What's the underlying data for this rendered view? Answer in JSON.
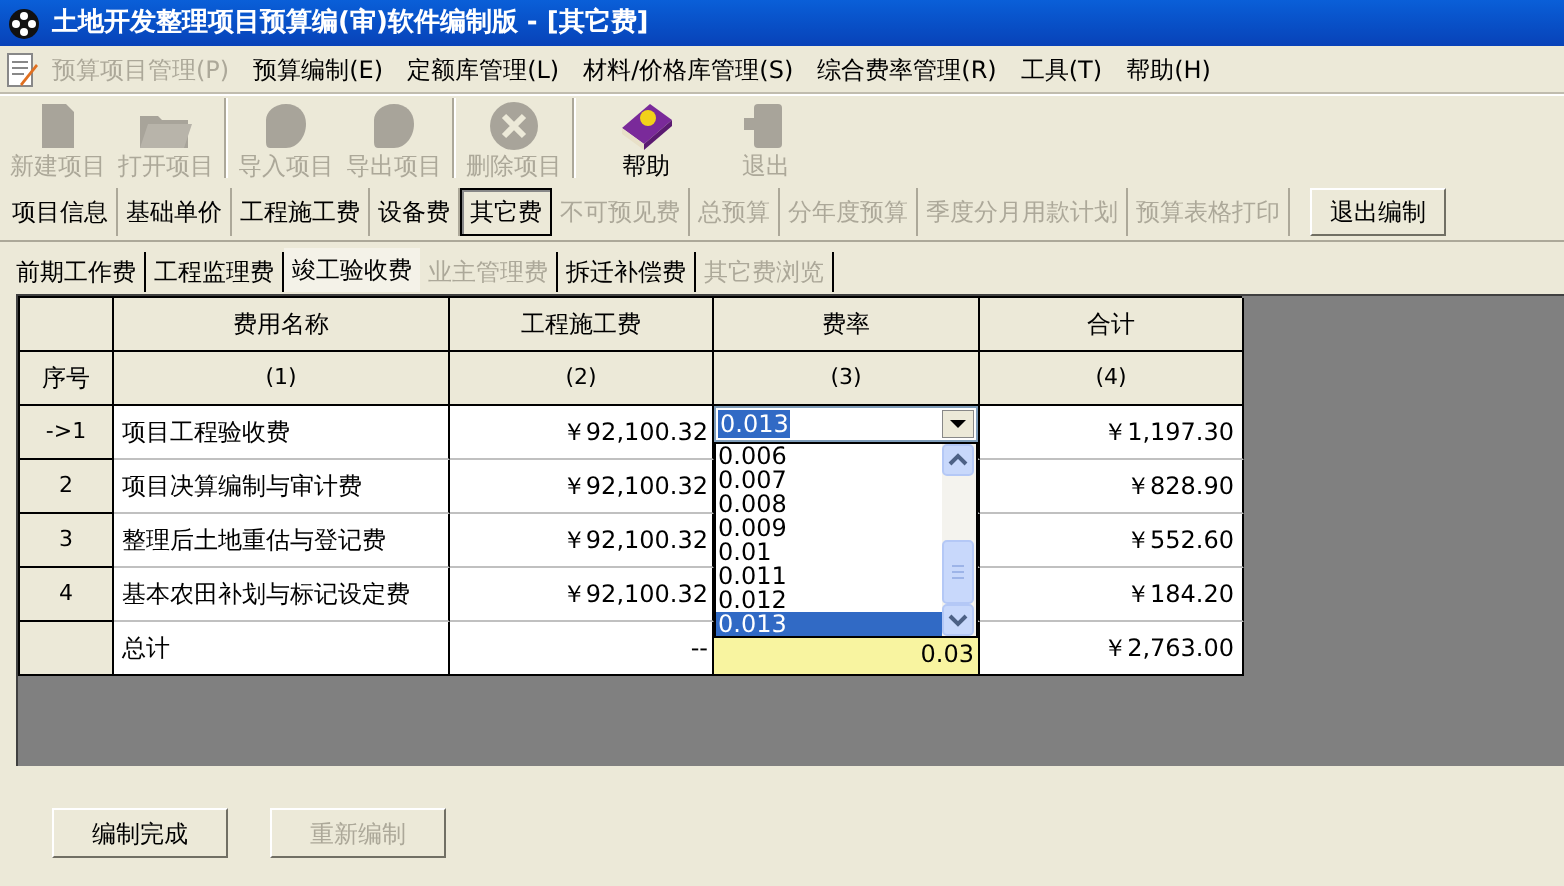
{
  "window": {
    "title": "土地开发整理项目预算编(审)软件编制版 - [其它费]"
  },
  "menu": [
    {
      "label": "预算项目管理(P)",
      "disabled": true
    },
    {
      "label": "预算编制(E)",
      "disabled": false
    },
    {
      "label": "定额库管理(L)",
      "disabled": false
    },
    {
      "label": "材料/价格库管理(S)",
      "disabled": false
    },
    {
      "label": "综合费率管理(R)",
      "disabled": false
    },
    {
      "label": "工具(T)",
      "disabled": false
    },
    {
      "label": "帮助(H)",
      "disabled": false
    }
  ],
  "toolbar": [
    {
      "label": "新建项目",
      "kind": "new",
      "disabled": true
    },
    {
      "label": "打开项目",
      "kind": "open",
      "disabled": true
    },
    {
      "label": "导入项目",
      "kind": "import",
      "disabled": true
    },
    {
      "label": "导出项目",
      "kind": "export",
      "disabled": true
    },
    {
      "label": "删除项目",
      "kind": "delete",
      "disabled": true
    },
    {
      "label": "帮助",
      "kind": "help",
      "disabled": false
    },
    {
      "label": "退出",
      "kind": "exit",
      "disabled": true
    }
  ],
  "nav_tabs": [
    {
      "label": "项目信息",
      "selected": false,
      "disabled": false
    },
    {
      "label": "基础单价",
      "selected": false,
      "disabled": false
    },
    {
      "label": "工程施工费",
      "selected": false,
      "disabled": false
    },
    {
      "label": "设备费",
      "selected": false,
      "disabled": false
    },
    {
      "label": "其它费",
      "selected": true,
      "disabled": false
    },
    {
      "label": "不可预见费",
      "selected": false,
      "disabled": true
    },
    {
      "label": "总预算",
      "selected": false,
      "disabled": true
    },
    {
      "label": "分年度预算",
      "selected": false,
      "disabled": true
    },
    {
      "label": "季度分月用款计划",
      "selected": false,
      "disabled": true
    },
    {
      "label": "预算表格打印",
      "selected": false,
      "disabled": true
    }
  ],
  "exit_edit_button": "退出编制",
  "sub_tabs": [
    {
      "label": "前期工作费",
      "selected": false,
      "disabled": false
    },
    {
      "label": "工程监理费",
      "selected": false,
      "disabled": false
    },
    {
      "label": "竣工验收费",
      "selected": true,
      "disabled": false
    },
    {
      "label": "业主管理费",
      "selected": false,
      "disabled": true
    },
    {
      "label": "拆迁补偿费",
      "selected": false,
      "disabled": false
    },
    {
      "label": "其它费浏览",
      "selected": false,
      "disabled": true
    }
  ],
  "table": {
    "index_header": "序号",
    "columns": [
      {
        "header": "费用名称",
        "sub": "(1)"
      },
      {
        "header": "工程施工费",
        "sub": "(2)"
      },
      {
        "header": "费率",
        "sub": "(3)"
      },
      {
        "header": "合计",
        "sub": "(4)"
      }
    ],
    "rows": [
      {
        "index": "->1",
        "name": "项目工程验收费",
        "cost": "￥92,100.32",
        "total": "￥1,197.30"
      },
      {
        "index": "2",
        "name": "项目决算编制与审计费",
        "cost": "￥92,100.32",
        "total": "￥828.90"
      },
      {
        "index": "3",
        "name": "整理后土地重估与登记费",
        "cost": "￥92,100.32",
        "total": "￥552.60"
      },
      {
        "index": "4",
        "name": "基本农田补划与标记设定费",
        "cost": "￥92,100.32",
        "total": "￥184.20"
      }
    ],
    "total_row": {
      "name": "总计",
      "cost": "--",
      "rate": "0.03",
      "total": "￥2,763.00"
    }
  },
  "rate_dropdown": {
    "value": "0.013",
    "options": [
      {
        "label": "0.006",
        "selected": false
      },
      {
        "label": "0.007",
        "selected": false
      },
      {
        "label": "0.008",
        "selected": false
      },
      {
        "label": "0.009",
        "selected": false
      },
      {
        "label": "0.01",
        "selected": false
      },
      {
        "label": "0.011",
        "selected": false
      },
      {
        "label": "0.012",
        "selected": false
      },
      {
        "label": "0.013",
        "selected": true
      }
    ]
  },
  "buttons": [
    {
      "label": "编制完成",
      "disabled": false
    },
    {
      "label": "重新编制",
      "disabled": true
    }
  ]
}
